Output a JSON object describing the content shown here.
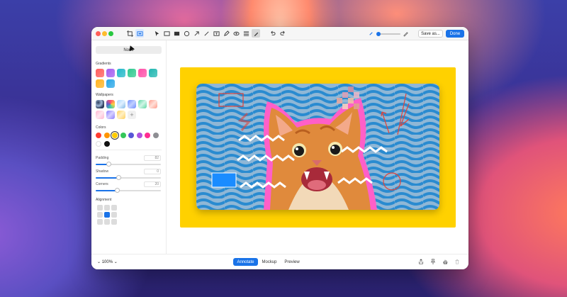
{
  "toolbar": {
    "save_label": "Save as...",
    "done_label": "Done"
  },
  "sidebar": {
    "background_mode": "None",
    "gradients_label": "Gradients",
    "wallpapers_label": "Wallpapers",
    "colors_label": "Colors",
    "padding_label": "Padding",
    "padding_value": "82",
    "padding_level": 0.2,
    "shadow_label": "Shadow",
    "shadow_value": "0",
    "shadow_level": 0.35,
    "corners_label": "Corners",
    "corners_value": "20",
    "corners_level": 0.33,
    "alignment_label": "Alignment",
    "gradients": [
      "#ff5b5b",
      "#a35cf0",
      "#20b8c8",
      "#2ec98f",
      "#ff4fa8",
      "#1fb6b0",
      "#ffb21f",
      "#27a6e8"
    ],
    "colors": [
      "#ff3b30",
      "#ff9500",
      "#ffcc00",
      "#34c759",
      "#5856d6",
      "#af52de",
      "#ff2d92",
      "#8e8e93",
      "#ffffff",
      "#111111"
    ]
  },
  "bottom": {
    "zoom": "100%",
    "tab_annotate": "Annotate",
    "tab_mockup": "Mockup",
    "tab_preview": "Preview"
  },
  "colors": {
    "accent": "#1a73e8",
    "frame": "#ffd100"
  }
}
